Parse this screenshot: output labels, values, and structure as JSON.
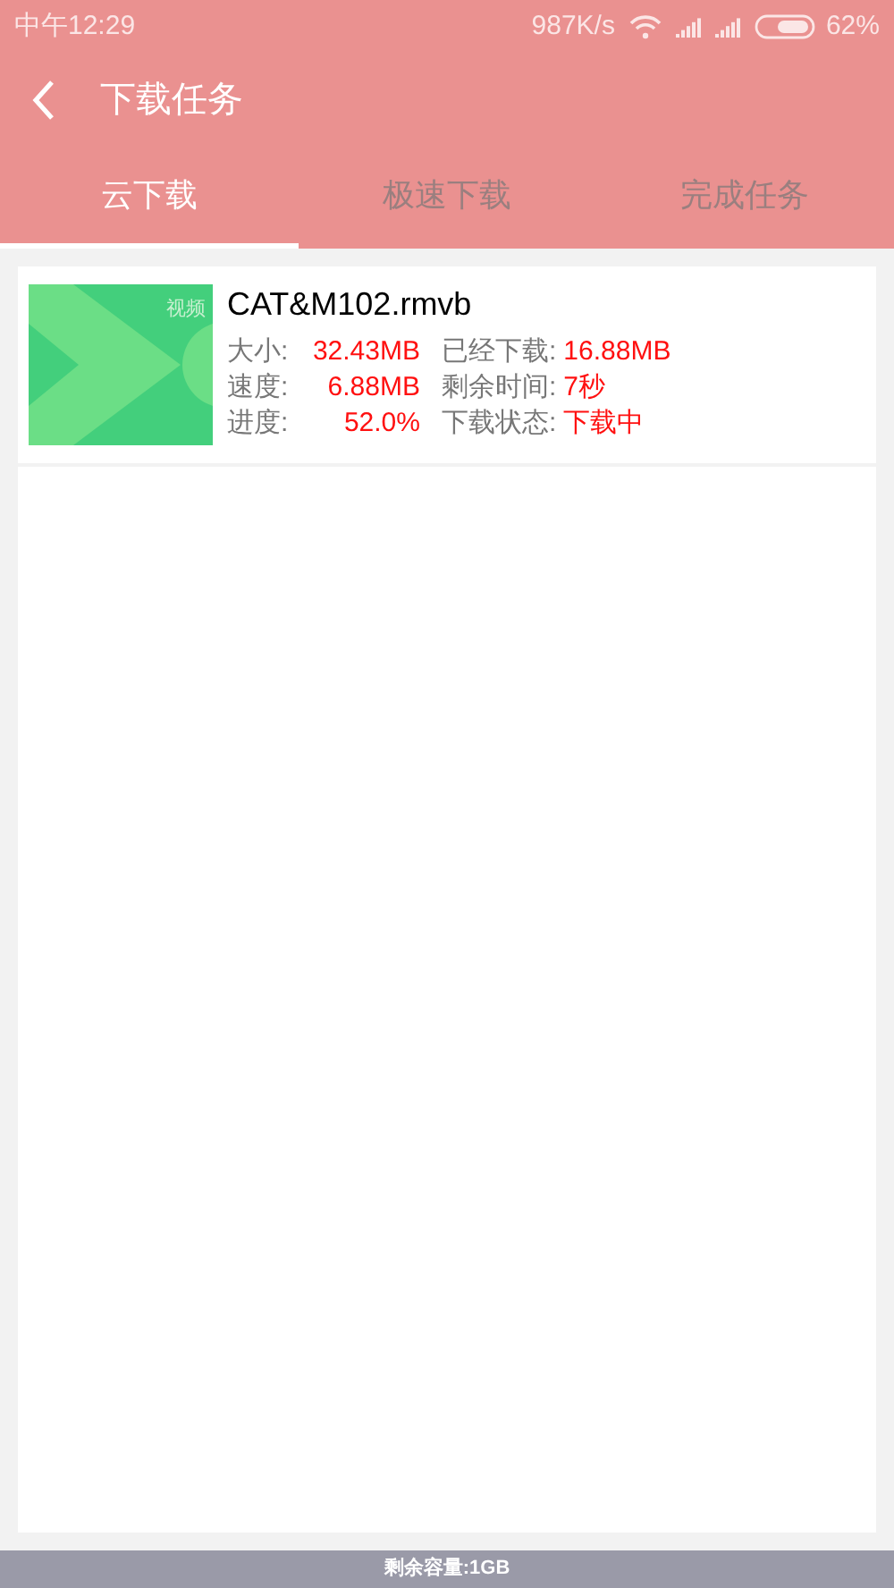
{
  "status_bar": {
    "time": "中午12:29",
    "speed": "987K/s",
    "battery": "62%"
  },
  "header": {
    "title": "下载任务"
  },
  "tabs": [
    {
      "label": "云下载",
      "selected": true
    },
    {
      "label": "极速下载",
      "selected": false
    },
    {
      "label": "完成任务",
      "selected": false
    }
  ],
  "tasks": [
    {
      "thumbnail_label": "视频",
      "name": "CAT&M102.rmvb",
      "rows": [
        [
          {
            "label": "大小:",
            "value": "32.43MB"
          },
          {
            "label": "已经下载:",
            "value": "16.88MB"
          }
        ],
        [
          {
            "label": "速度:",
            "value": "6.88MB"
          },
          {
            "label": "剩余时间:",
            "value": "7秒"
          }
        ],
        [
          {
            "label": "进度:",
            "value": "52.0%"
          },
          {
            "label": "下载状态:",
            "value": "下载中"
          }
        ]
      ]
    }
  ],
  "footer": {
    "capacity": "剩余容量:1GB"
  }
}
